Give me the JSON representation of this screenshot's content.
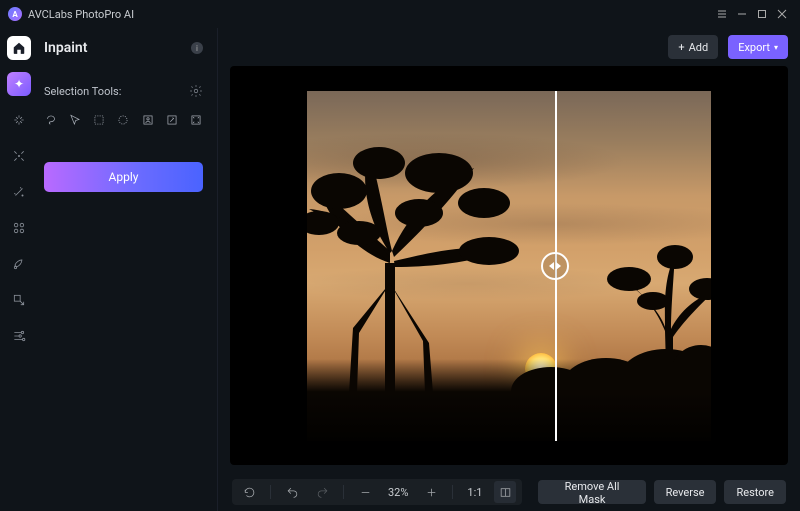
{
  "app": {
    "title": "AVCLabs PhotoPro AI"
  },
  "sidebar": {
    "title": "Inpaint",
    "selection_label": "Selection Tools:",
    "apply_label": "Apply"
  },
  "topbar": {
    "add_label": "Add",
    "export_label": "Export"
  },
  "bottombar": {
    "zoom": "32%",
    "fit_label": "1:1",
    "remove_mask": "Remove All Mask",
    "reverse": "Reverse",
    "restore": "Restore"
  }
}
